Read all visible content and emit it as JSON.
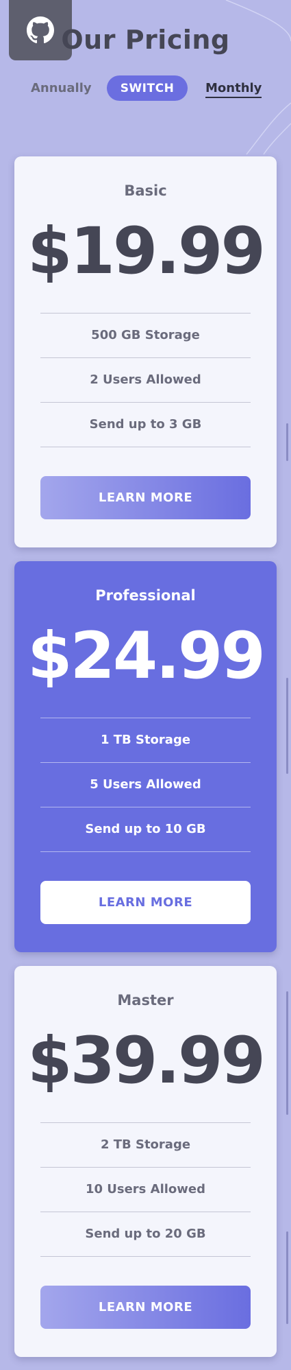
{
  "header": {
    "title": "Our Pricing",
    "github_icon": "github-icon"
  },
  "period_toggle": {
    "annually_label": "Annually",
    "switch_label": "SWITCH",
    "monthly_label": "Monthly",
    "selected": "Monthly"
  },
  "plans": [
    {
      "name": "Basic",
      "price": "$19.99",
      "features": [
        "500 GB Storage",
        "2 Users Allowed",
        "Send up to 3 GB"
      ],
      "button_label": "LEARN MORE"
    },
    {
      "name": "Professional",
      "price": "$24.99",
      "features": [
        "1 TB Storage",
        "5 Users Allowed",
        "Send up to 10 GB"
      ],
      "button_label": "LEARN MORE",
      "featured": true
    },
    {
      "name": "Master",
      "price": "$39.99",
      "features": [
        "2 TB Storage",
        "10 Users Allowed",
        "Send up to 20 GB"
      ],
      "button_label": "LEARN MORE"
    }
  ],
  "colors": {
    "background": "#b6b8e8",
    "accent": "#686ee0",
    "card": "#f4f5fc",
    "text_dark": "#454655"
  }
}
